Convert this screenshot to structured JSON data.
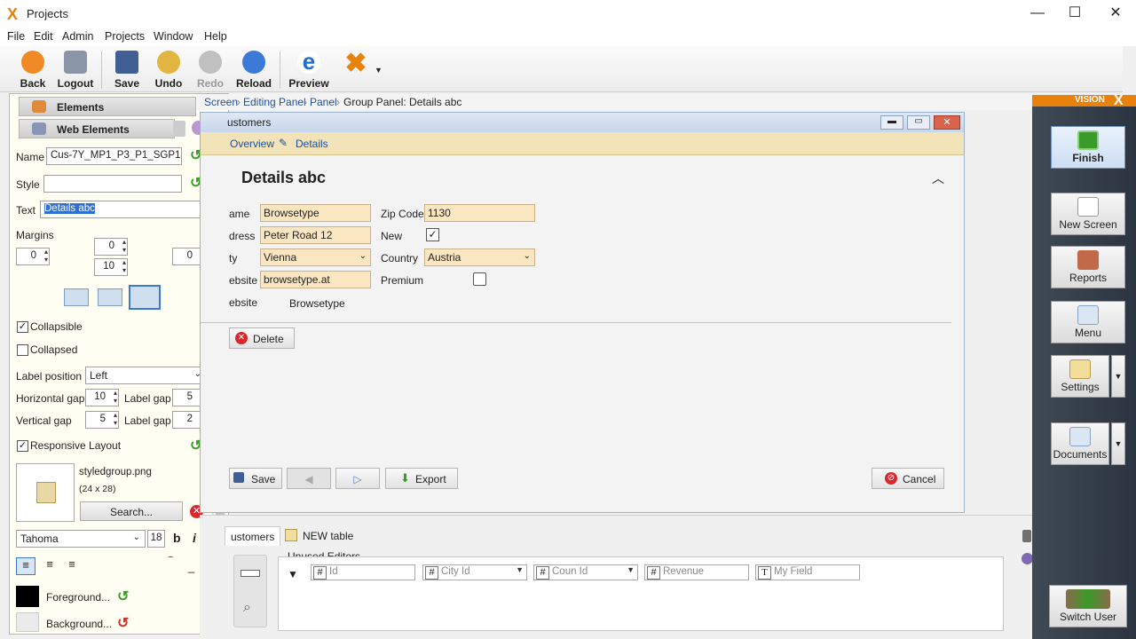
{
  "window": {
    "title": "Projects",
    "minimize": "—",
    "maximize": "☐",
    "close": "✕"
  },
  "menu": [
    "File",
    "Edit",
    "Admin",
    "Projects",
    "Window",
    "Help"
  ],
  "toolbar": {
    "back": "Back",
    "logout": "Logout",
    "save": "Save",
    "undo": "Undo",
    "redo": "Redo",
    "reload": "Reload",
    "preview": "Preview"
  },
  "left": {
    "accordion": {
      "elements": "Elements",
      "web_elements": "Web Elements"
    },
    "props": {
      "name_label": "Name",
      "name_value": "Cus-7Y_MP1_P3_P1_SGP1",
      "style_label": "Style",
      "style_value": "",
      "text_label": "Text",
      "text_value": "Details abc",
      "margins_label": "Margins",
      "margin_top": "0",
      "margin_left": "0",
      "margin_right": "0",
      "margin_bottom": "10",
      "collapsible_label": "Collapsible",
      "collapsed_label": "Collapsed",
      "label_position_label": "Label position",
      "label_position_value": "Left",
      "hgap_label": "Horizontal gap",
      "hgap_value": "10",
      "label_gap_label": "Label gap",
      "hlabel_gap_value": "5",
      "vgap_label": "Vertical gap",
      "vgap_value": "5",
      "vlabel_gap_value": "2",
      "responsive_label": "Responsive Layout",
      "image_name": "styledgroup.png",
      "image_size": "(24 x 28)",
      "search_button": "Search...",
      "font_value": "Tahoma",
      "font_size": "18",
      "bold": "b",
      "italic": "i",
      "foreground_button": "Foreground...",
      "background_button": "Background..."
    }
  },
  "breadcrumb": [
    "Screen",
    "Editing Panel",
    "Panel",
    "Group Panel: Details abc"
  ],
  "editor": {
    "window_title": "ustomers",
    "tabs": [
      "Overview",
      "Details"
    ],
    "group_title": "Details abc",
    "fields": {
      "name_label": "ame",
      "name_value": "Browsetype",
      "address_label": "dress",
      "address_value": "Peter Road 12",
      "city_label": "ty",
      "city_value": "Vienna",
      "website_label": "ebsite",
      "website_value": "browsetype.at",
      "website2_label": "ebsite",
      "website2_value": "Browsetype",
      "zip_label": "Zip Code",
      "zip_value": "1130",
      "new_label": "New",
      "country_label": "Country",
      "country_value": "Austria",
      "premium_label": "Premium"
    },
    "delete_button": "Delete",
    "save_button": "Save",
    "export_button": "Export",
    "cancel_button": "Cancel"
  },
  "bottom": {
    "tabs": [
      "ustomers",
      "NEW table"
    ],
    "unused_label": "Unused Editors",
    "unused_fields": [
      "Id",
      "City Id",
      "Coun Id",
      "Revenue",
      "My Field"
    ]
  },
  "right": {
    "brand": "VISION",
    "buttons": [
      "Finish",
      "New Screen",
      "Reports",
      "Menu",
      "Settings",
      "Documents",
      "Switch User"
    ]
  },
  "colors": {
    "accent_orange": "#e8820c",
    "link_blue": "#1d4f9a",
    "field_bg": "#fbe6c2",
    "delete_red": "#d9272e"
  }
}
